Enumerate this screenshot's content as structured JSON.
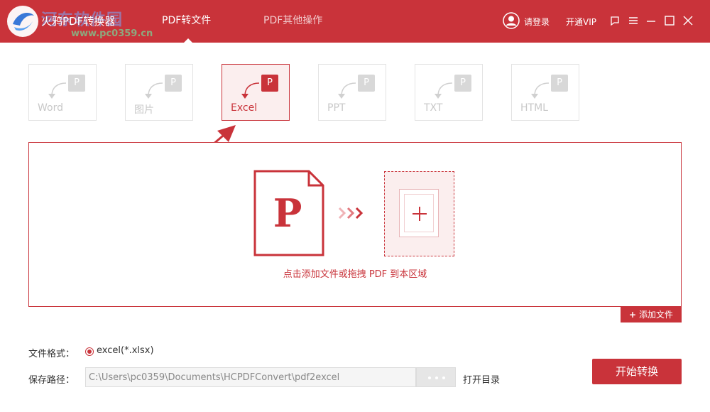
{
  "app": {
    "title": "火鸦PDF转换器",
    "watermark_text": "河东软件园",
    "watermark_url": "www.pc0359.cn"
  },
  "nav": {
    "tabs": [
      {
        "label": "PDF转文件",
        "active": true
      },
      {
        "label": "PDF其他操作",
        "active": false
      }
    ]
  },
  "toolbar": {
    "login_label": "请登录",
    "vip_label": "开通VIP"
  },
  "formats": [
    {
      "label": "Word",
      "badge": "P",
      "active": false
    },
    {
      "label": "图片",
      "badge": "P",
      "active": false
    },
    {
      "label": "Excel",
      "badge": "P",
      "active": true
    },
    {
      "label": "PPT",
      "badge": "P",
      "active": false
    },
    {
      "label": "TXT",
      "badge": "P",
      "active": false
    },
    {
      "label": "HTML",
      "badge": "P",
      "active": false
    }
  ],
  "dropzone": {
    "doc_letter": "P",
    "hint": "点击添加文件或拖拽 PDF 到本区域"
  },
  "add_file_label": "添加文件",
  "settings": {
    "format_label": "文件格式：",
    "format_option": "excel(*.xlsx)",
    "path_label": "保存路径：",
    "path_value": "C:\\Users\\pc0359\\Documents\\HCPDFConvert\\pdf2excel",
    "open_dir_label": "打开目录"
  },
  "start_label": "开始转换",
  "colors": {
    "brand": "#c9333a",
    "disabled": "#c8c8c8"
  }
}
